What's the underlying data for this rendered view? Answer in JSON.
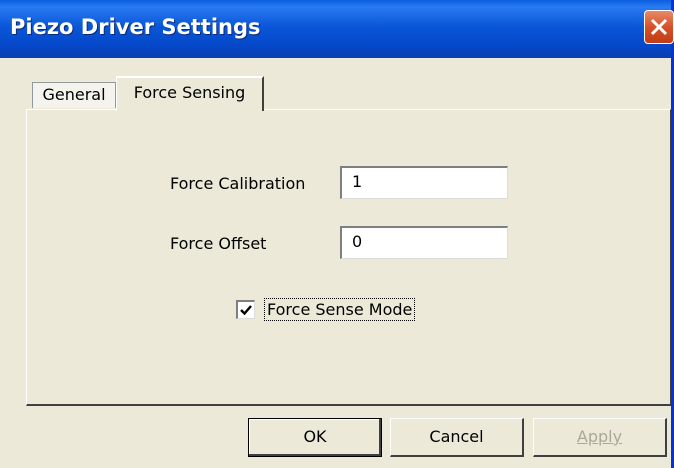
{
  "window": {
    "title": "Piezo Driver Settings"
  },
  "tabs": [
    {
      "label": "General",
      "selected": false
    },
    {
      "label": "Force Sensing",
      "selected": true
    }
  ],
  "form": {
    "force_calibration": {
      "label": "Force Calibration",
      "value": "1"
    },
    "force_offset": {
      "label": "Force Offset",
      "value": "0"
    },
    "force_sense_mode": {
      "label": "Force Sense Mode",
      "checked": true
    }
  },
  "buttons": {
    "ok": "OK",
    "cancel": "Cancel",
    "apply": "Apply",
    "apply_enabled": false
  },
  "icons": {
    "close": "close-icon",
    "check": "checkmark-icon"
  },
  "colors": {
    "titlebar": "#0a57d8",
    "close_button": "#d6512a",
    "dialog_background": "#ece9d8"
  }
}
